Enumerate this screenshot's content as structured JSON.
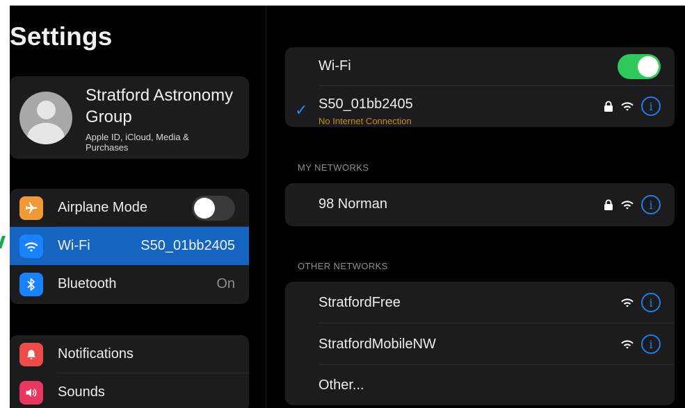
{
  "sidebar": {
    "title": "Settings",
    "profile": {
      "name": "Stratford Astronomy Group",
      "subtitle": "Apple ID, iCloud, Media & Purchases"
    },
    "group1": [
      {
        "icon": "airplane-icon",
        "color": "#f09a37",
        "label": "Airplane Mode",
        "toggle_on": false
      },
      {
        "icon": "wifi-icon",
        "color": "#1a82ff",
        "label": "Wi-Fi",
        "value": "S50_01bb2405",
        "selected": true
      },
      {
        "icon": "bluetooth-icon",
        "color": "#1a82ff",
        "label": "Bluetooth",
        "value": "On"
      }
    ],
    "group2": [
      {
        "icon": "bell-icon",
        "color": "#ee4b4b",
        "label": "Notifications"
      },
      {
        "icon": "speaker-icon",
        "color": "#e8385f",
        "label": "Sounds"
      }
    ]
  },
  "wifi": {
    "label": "Wi-Fi",
    "enabled": true,
    "connected": {
      "name": "S50_01bb2405",
      "status": "No Internet Connection",
      "locked": true
    },
    "my_networks_header": "MY NETWORKS",
    "my_networks": [
      {
        "name": "98 Norman",
        "locked": true
      }
    ],
    "other_networks_header": "OTHER NETWORKS",
    "other_networks": [
      {
        "name": "StratfordFree",
        "locked": false
      },
      {
        "name": "StratfordMobileNW",
        "locked": false
      }
    ],
    "other_label": "Other..."
  },
  "colors": {
    "accent": "#1565c0",
    "toggle_on": "#30c85a",
    "warning": "#c98a0c",
    "link": "#1e7fe6"
  }
}
